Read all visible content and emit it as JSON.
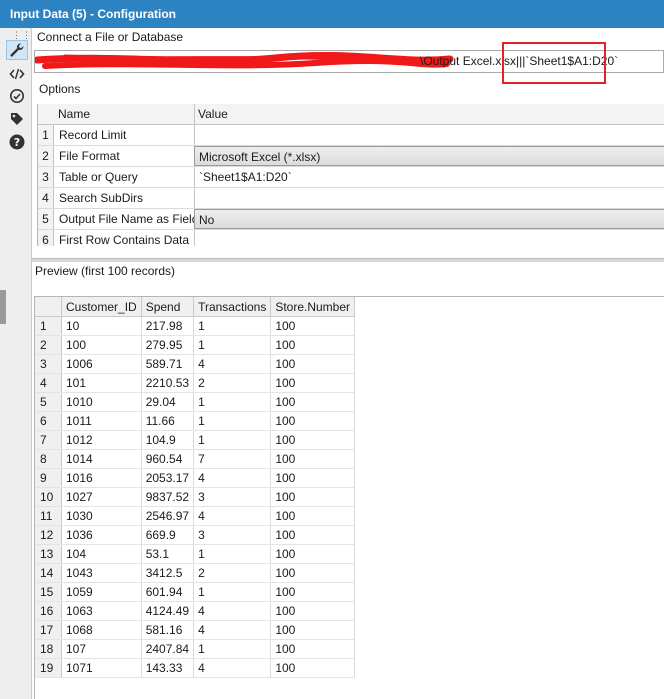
{
  "window": {
    "title": "Input Data (5) - Configuration"
  },
  "sidebar": {
    "icons": [
      "wrench-icon",
      "code-icon",
      "annotation-icon",
      "tag-icon",
      "help-icon"
    ]
  },
  "connection": {
    "label": "Connect a File or Database",
    "path_visible": "\\Output Excel.xlsx|||`Sheet1$A1:D20`"
  },
  "options": {
    "label": "Options",
    "headers": {
      "name": "Name",
      "value": "Value"
    },
    "rows": [
      {
        "num": "1",
        "name": "Record Limit",
        "value": ""
      },
      {
        "num": "2",
        "name": "File Format",
        "value": "Microsoft Excel (*.xlsx)"
      },
      {
        "num": "3",
        "name": "Table or Query",
        "value": "`Sheet1$A1:D20`"
      },
      {
        "num": "4",
        "name": "Search SubDirs",
        "value": ""
      },
      {
        "num": "5",
        "name": "Output File Name as Field",
        "value": "No"
      },
      {
        "num": "6",
        "name": "First Row Contains Data",
        "value": ""
      }
    ]
  },
  "preview": {
    "label": "Preview (first 100 records)",
    "columns": [
      "",
      "Customer_ID",
      "Spend",
      "Transactions",
      "Store.Number"
    ],
    "rows": [
      [
        "1",
        "10",
        "217.98",
        "1",
        "100"
      ],
      [
        "2",
        "100",
        "279.95",
        "1",
        "100"
      ],
      [
        "3",
        "1006",
        "589.71",
        "4",
        "100"
      ],
      [
        "4",
        "101",
        "2210.53",
        "2",
        "100"
      ],
      [
        "5",
        "1010",
        "29.04",
        "1",
        "100"
      ],
      [
        "6",
        "1011",
        "11.66",
        "1",
        "100"
      ],
      [
        "7",
        "1012",
        "104.9",
        "1",
        "100"
      ],
      [
        "8",
        "1014",
        "960.54",
        "7",
        "100"
      ],
      [
        "9",
        "1016",
        "2053.17",
        "4",
        "100"
      ],
      [
        "10",
        "1027",
        "9837.52",
        "3",
        "100"
      ],
      [
        "11",
        "1030",
        "2546.97",
        "4",
        "100"
      ],
      [
        "12",
        "1036",
        "669.9",
        "3",
        "100"
      ],
      [
        "13",
        "104",
        "53.1",
        "1",
        "100"
      ],
      [
        "14",
        "1043",
        "3412.5",
        "2",
        "100"
      ],
      [
        "15",
        "1059",
        "601.94",
        "1",
        "100"
      ],
      [
        "16",
        "1063",
        "4124.49",
        "4",
        "100"
      ],
      [
        "17",
        "1068",
        "581.16",
        "4",
        "100"
      ],
      [
        "18",
        "107",
        "2407.84",
        "1",
        "100"
      ],
      [
        "19",
        "1071",
        "143.33",
        "4",
        "100"
      ]
    ]
  },
  "colors": {
    "titlebar": "#2d83c1",
    "highlight": "#e4202a",
    "redaction": "#f01818"
  }
}
